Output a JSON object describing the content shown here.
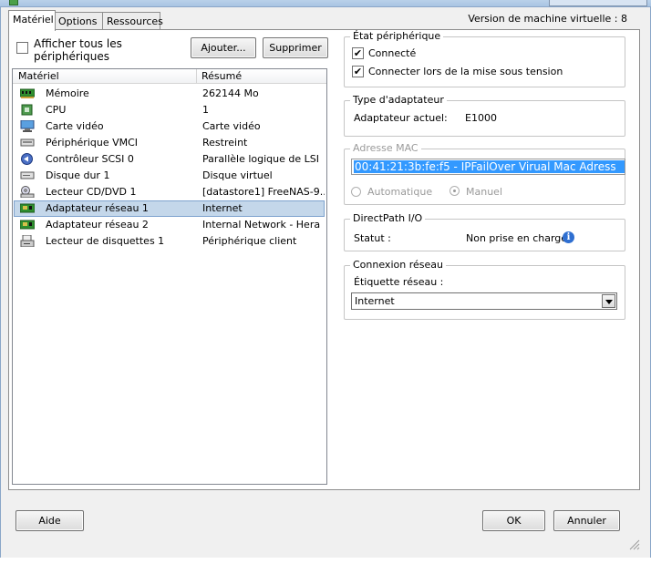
{
  "tabs": [
    {
      "label": "Matériel",
      "active": true
    },
    {
      "label": "Options",
      "active": false
    },
    {
      "label": "Ressources",
      "active": false
    }
  ],
  "vm_version": "Version de machine virtuelle : 8",
  "show_all": {
    "label_line1": "Afficher tous les",
    "label_line2": "périphériques",
    "checked": false
  },
  "buttons": {
    "add": "Ajouter...",
    "remove": "Supprimer",
    "help": "Aide",
    "ok": "OK",
    "cancel": "Annuler"
  },
  "hardware_list": {
    "col_hardware": "Matériel",
    "col_summary": "Résumé",
    "rows": [
      {
        "name": "Mémoire",
        "summary": "262144 Mo",
        "icon": "memory-icon"
      },
      {
        "name": "CPU",
        "summary": "1",
        "icon": "cpu-icon"
      },
      {
        "name": "Carte vidéo",
        "summary": "Carte vidéo",
        "icon": "video-card-icon"
      },
      {
        "name": "Périphérique VMCI",
        "summary": "Restreint",
        "icon": "vmci-icon"
      },
      {
        "name": "Contrôleur SCSI 0",
        "summary": "Parallèle logique de LSI",
        "icon": "scsi-controller-icon"
      },
      {
        "name": "Disque dur 1",
        "summary": "Disque virtuel",
        "icon": "hard-disk-icon"
      },
      {
        "name": "Lecteur CD/DVD 1",
        "summary": "[datastore1] FreeNAS-9...",
        "icon": "cd-dvd-icon"
      },
      {
        "name": "Adaptateur réseau 1",
        "summary": "Internet",
        "icon": "network-adapter-icon",
        "selected": true
      },
      {
        "name": "Adaptateur réseau 2",
        "summary": "Internal Network - Hera",
        "icon": "network-adapter-icon"
      },
      {
        "name": "Lecteur de disquettes 1",
        "summary": "Périphérique client",
        "icon": "floppy-drive-icon"
      }
    ]
  },
  "device_status": {
    "legend": "État périphérique",
    "connected_label": "Connecté",
    "connected_checked": true,
    "connect_at_power_on_label": "Connecter lors de la mise sous tension",
    "connect_at_power_on_checked": true
  },
  "adapter_type": {
    "legend": "Type d'adaptateur",
    "current_label": "Adaptateur actuel:",
    "current_value": "E1000"
  },
  "mac_address": {
    "legend": "Adresse MAC",
    "value": "00:41:21:3b:fe:f5  - IPFailOver Virual Mac Adress",
    "automatic_label": "Automatique",
    "manual_label": "Manuel",
    "selected": "Manuel"
  },
  "directpath": {
    "legend": "DirectPath I/O",
    "status_label": "Statut :",
    "status_value": "Non prise en charge"
  },
  "network_connection": {
    "legend": "Connexion réseau",
    "label_field": "Étiquette réseau :",
    "selected": "Internet"
  },
  "colors": {
    "selection": "#c4d7ea",
    "mac_highlight": "#3399ff",
    "info": "#2f6fd1"
  }
}
